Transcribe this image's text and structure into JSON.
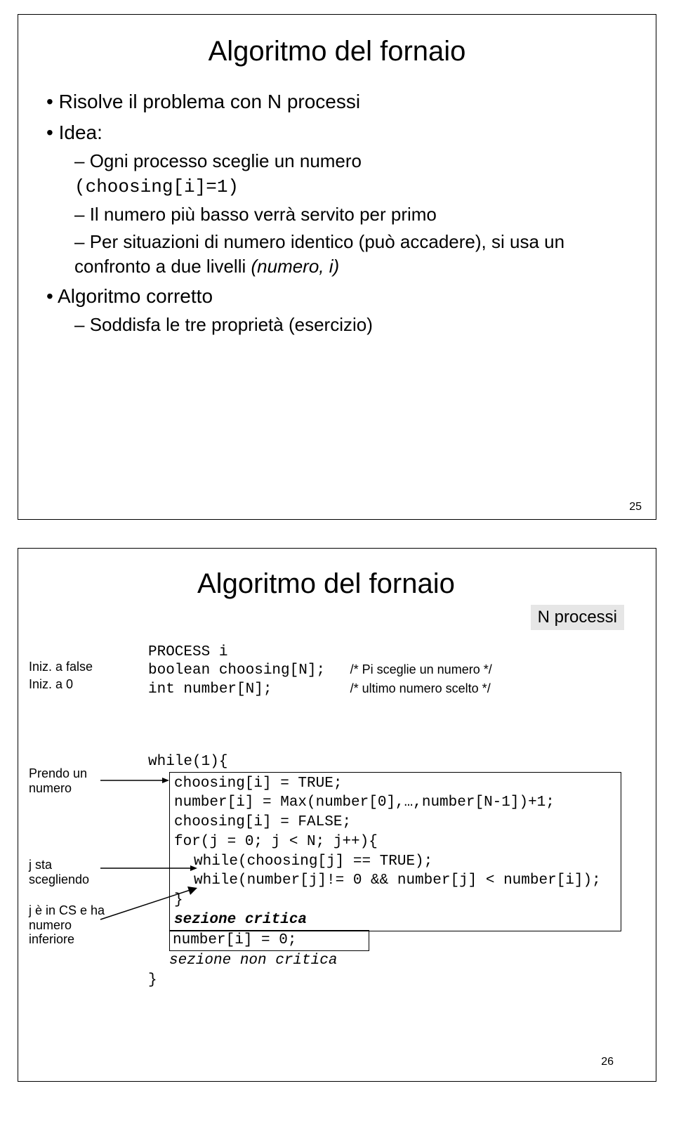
{
  "slide1": {
    "title": "Algoritmo del fornaio",
    "b1": "Risolve il problema con N processi",
    "b2": "Idea:",
    "b2a": "Ogni processo sceglie un numero",
    "b2a_code": "(choosing[i]=1)",
    "b2b": "Il numero più basso verrà servito per primo",
    "b2c_1": "Per situazioni di numero identico (può accadere), si usa un confronto a due livelli ",
    "b2c_i": "(numero, i)",
    "b3": "Algoritmo corretto",
    "b3a": "Soddisfa le tre proprietà (esercizio)",
    "page": "25"
  },
  "slide2": {
    "title": "Algoritmo del fornaio",
    "badge": "N processi",
    "note_init_false": "Iniz. a false",
    "note_init_0": "Iniz. a 0",
    "note_prendo": "Prendo un numero",
    "note_jsta": "j sta scegliendo",
    "note_jcs": "j è in CS e ha numero inferiore",
    "decl": {
      "l1": "PROCESS i",
      "l2a": "boolean choosing[N];",
      "l2b": "/* Pi sceglie un numero */",
      "l3a": "int number[N];",
      "l3b": "/* ultimo numero scelto */"
    },
    "code": {
      "l1": "while(1){",
      "l2": "choosing[i] = TRUE;",
      "l3": "number[i] = Max(number[0],…,number[N-1])+1;",
      "l4": "choosing[i] = FALSE;",
      "l5": "for(j = 0; j < N; j++){",
      "l6": "while(choosing[j] == TRUE);",
      "l7": "while(number[j]!= 0 && number[j] < number[i]);",
      "l8": "}",
      "l9": "sezione critica",
      "l10": "number[i] = 0;",
      "l11": "sezione non critica",
      "l12": "}"
    },
    "page": "26"
  }
}
